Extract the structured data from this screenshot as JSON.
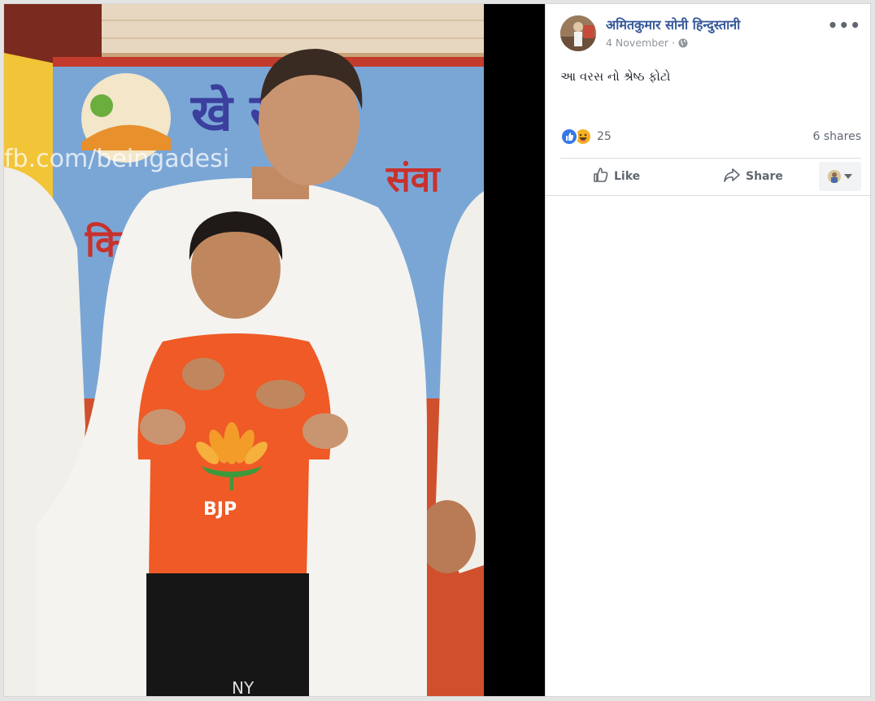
{
  "post": {
    "author": "अमितकुमार सोनी हिन्दुस्तानी",
    "date": "4 November",
    "date_separator": "·",
    "text": "આ વરસ નો શ્રેષ્ઠ ફોટો",
    "reaction_count": "25",
    "shares": "6 shares",
    "more_label": "•••"
  },
  "actions": {
    "like_label": "Like",
    "share_label": "Share"
  },
  "photo": {
    "watermark": "fb.com/beingadesi",
    "banner_text": "खे समा",
    "banner_text_2": "संवा",
    "banner_text_3": "किर     . श्री",
    "shirt_text": "BJP",
    "pants_text": "NY"
  },
  "colors": {
    "link": "#365899",
    "secondary": "#90949c",
    "like_blue": "#3578e5",
    "haha_yellow": "#f7b125",
    "shirt_orange": "#ef5a26",
    "banner_blue": "#7aa6d6"
  }
}
